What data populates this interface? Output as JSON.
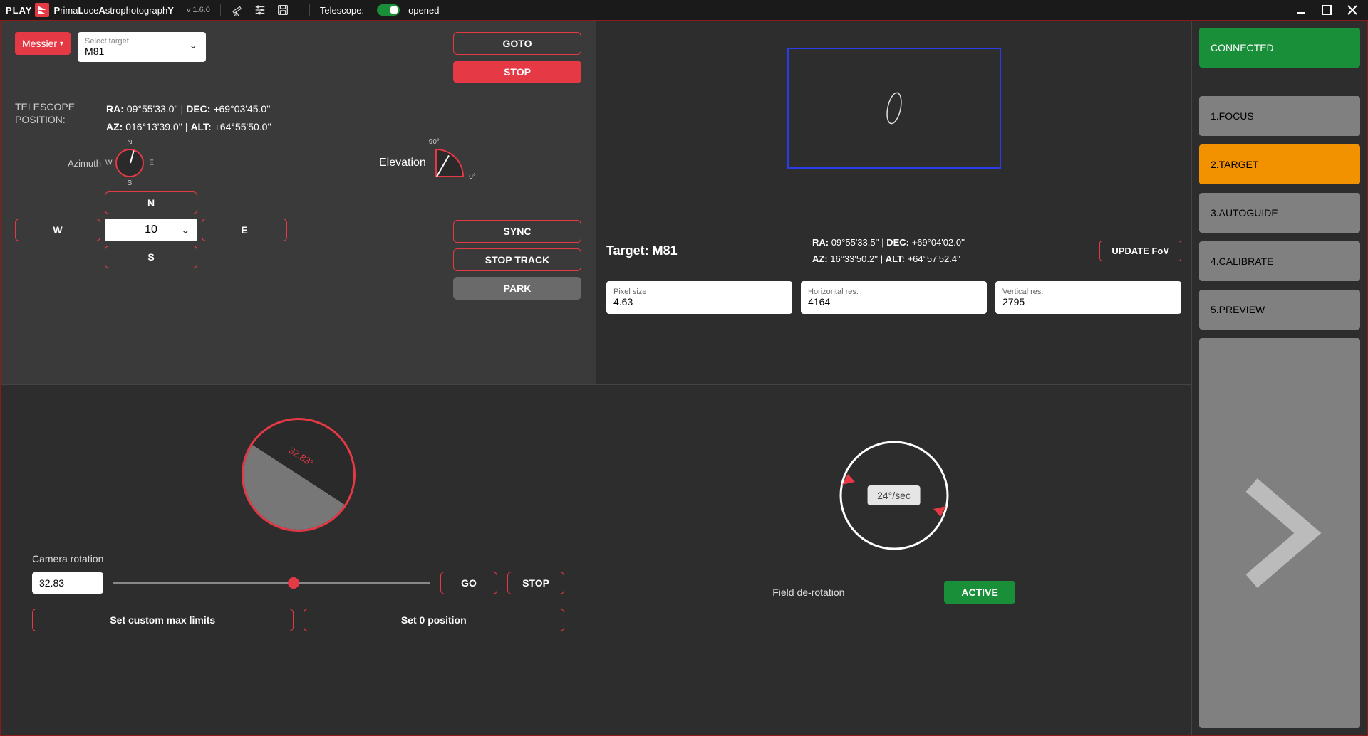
{
  "titlebar": {
    "play": "PLAY",
    "brand_pre": "P",
    "brand_mid1": "rima",
    "brand_l": "L",
    "brand_mid2": "uce",
    "brand_a": "A",
    "brand_mid3": "strophotograph",
    "brand_y": "Y",
    "version": "v 1.6.0",
    "telescope_label": "Telescope:",
    "status": "opened"
  },
  "sidebar": {
    "connected": "CONNECTED",
    "items": [
      "1.FOCUS",
      "2.TARGET",
      "3.AUTOGUIDE",
      "4.CALIBRATE",
      "5.PREVIEW"
    ]
  },
  "tl": {
    "catalog_btn": "Messier",
    "target_placeholder": "Select target",
    "target_value": "M81",
    "goto": "GOTO",
    "stop": "STOP",
    "pos_label1": "TELESCOPE",
    "pos_label2": "POSITION:",
    "ra": "09°55'33.0''",
    "dec": "+69°03'45.0''",
    "az": "016°13'39.0''",
    "alt": "+64°55'50.0''",
    "azimuth_label": "Azimuth",
    "elevation_label": "Elevation",
    "n": "N",
    "s": "S",
    "e": "E",
    "w": "W",
    "speed": "10",
    "sync": "SYNC",
    "stop_track": "STOP TRACK",
    "park": "PARK"
  },
  "tr": {
    "target_prefix": "Target: ",
    "target_name": "M81",
    "ra": "09°55'33.5''",
    "dec": "+69°04'02.0''",
    "az": "16°33'50.2''",
    "alt": "+64°57'52.4''",
    "update_fov": "UPDATE FoV",
    "pixel_size_label": "Pixel size",
    "pixel_size": "4.63",
    "hres_label": "Horizontal res.",
    "hres": "4164",
    "vres_label": "Vertical res.",
    "vres": "2795"
  },
  "bl": {
    "angle_text": "32.83°",
    "rotation_label": "Camera rotation",
    "rotation_value": "32.83",
    "go": "GO",
    "stop": "STOP",
    "set_limits": "Set custom max limits",
    "set_zero": "Set 0 position"
  },
  "br": {
    "speed": "24°/sec",
    "derotation_label": "Field de-rotation",
    "active": "ACTIVE"
  },
  "labels": {
    "ra": "RA:",
    "dec": "DEC:",
    "az": "AZ:",
    "alt": "ALT:"
  }
}
